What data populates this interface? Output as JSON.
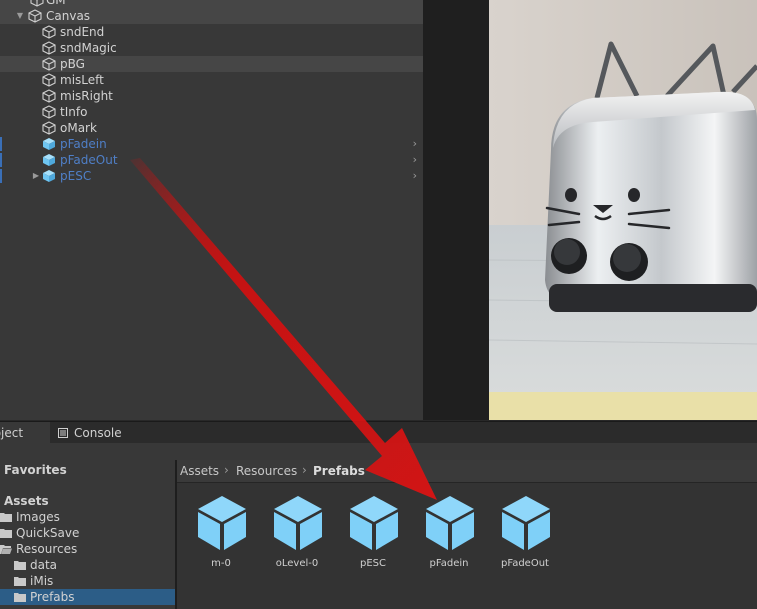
{
  "hierarchy": {
    "items": [
      {
        "label": "GM",
        "depth": 1,
        "foldable": false,
        "prefab": false
      },
      {
        "label": "Canvas",
        "depth": 1,
        "foldable": true,
        "prefab": false
      },
      {
        "label": "sndEnd",
        "depth": 2,
        "foldable": false,
        "prefab": false
      },
      {
        "label": "sndMagic",
        "depth": 2,
        "foldable": false,
        "prefab": false
      },
      {
        "label": "pBG",
        "depth": 2,
        "foldable": false,
        "prefab": false
      },
      {
        "label": "misLeft",
        "depth": 2,
        "foldable": false,
        "prefab": false
      },
      {
        "label": "misRight",
        "depth": 2,
        "foldable": false,
        "prefab": false
      },
      {
        "label": "tInfo",
        "depth": 2,
        "foldable": false,
        "prefab": false
      },
      {
        "label": "oMark",
        "depth": 2,
        "foldable": false,
        "prefab": false
      },
      {
        "label": "pFadein",
        "depth": 2,
        "foldable": false,
        "prefab": true
      },
      {
        "label": "pFadeOut",
        "depth": 2,
        "foldable": false,
        "prefab": true
      },
      {
        "label": "pESC",
        "depth": 2,
        "foldable": true,
        "prefab": true
      }
    ]
  },
  "tabs": {
    "project": "Project",
    "console": "Console"
  },
  "project": {
    "favorites_label": "Favorites",
    "assets_label": "Assets",
    "folders": [
      {
        "label": "Images"
      },
      {
        "label": "QuickSave"
      },
      {
        "label": "Resources"
      },
      {
        "label": "data"
      },
      {
        "label": "iMis"
      },
      {
        "label": "Prefabs"
      }
    ],
    "breadcrumb": [
      "Assets",
      "Resources",
      "Prefabs"
    ],
    "assets": [
      {
        "label": "m-0"
      },
      {
        "label": "oLevel-0"
      },
      {
        "label": "pESC"
      },
      {
        "label": "pFadein"
      },
      {
        "label": "pFadeOut"
      }
    ]
  },
  "colors": {
    "prefab_text": "#4f7fc7",
    "prefab_icon": "#7fd0f8",
    "selection": "#2c5d87",
    "arrow": "#cc1010"
  }
}
